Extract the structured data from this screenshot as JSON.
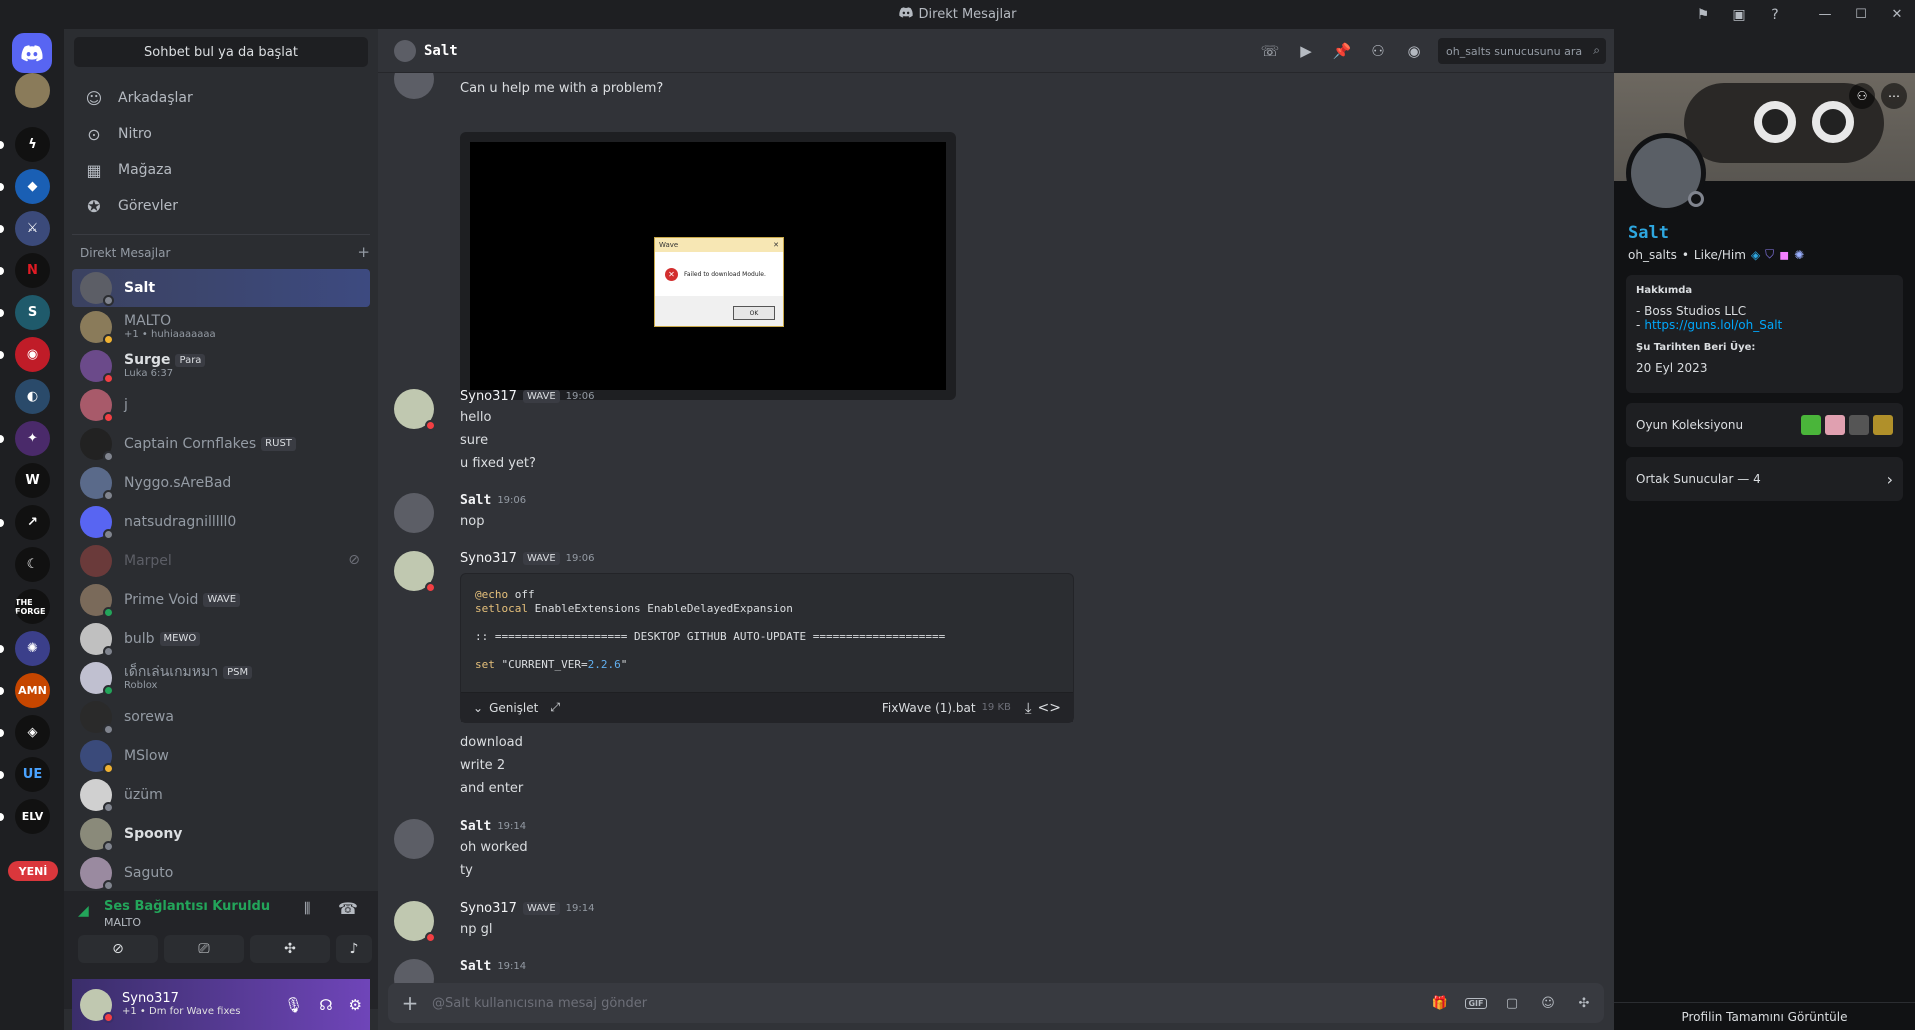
{
  "window": {
    "title": "Direkt Mesajlar",
    "controls": [
      "inbox-flag-icon",
      "inbox-icon",
      "help-icon"
    ]
  },
  "rail": {
    "new_badge": "YENİ",
    "servers": [
      {
        "name": "discord-home",
        "color": "#5865f2"
      },
      {
        "name": "server-a",
        "color": "#8a7b5a"
      },
      {
        "name": "server-b",
        "color": "#111111"
      },
      {
        "name": "server-c",
        "color": "#1a5fb4"
      },
      {
        "name": "server-d",
        "color": "#3b4a7a"
      },
      {
        "name": "server-e",
        "color": "#111111"
      },
      {
        "name": "server-f",
        "color": "#1f5a6b"
      },
      {
        "name": "server-g",
        "color": "#c01c28"
      },
      {
        "name": "server-h",
        "color": "#2a4a6a"
      },
      {
        "name": "server-i",
        "color": "#4a2a6a"
      },
      {
        "name": "server-j",
        "color": "#111111"
      },
      {
        "name": "server-k",
        "color": "#111111"
      },
      {
        "name": "server-l",
        "color": "#111111"
      },
      {
        "name": "server-forge",
        "color": "#111111",
        "text": "THE FORGE"
      },
      {
        "name": "server-m",
        "color": "#3b3f8a"
      },
      {
        "name": "server-amn",
        "color": "#c64600",
        "text": "AMN"
      },
      {
        "name": "server-n",
        "color": "#111111"
      },
      {
        "name": "server-ue",
        "color": "#111111",
        "text": "UE"
      },
      {
        "name": "server-elv",
        "color": "#111111",
        "text": "ELV"
      }
    ]
  },
  "sidebar": {
    "find_button": "Sohbet bul ya da başlat",
    "nav": [
      {
        "label": "Arkadaşlar",
        "icon": "friends-icon"
      },
      {
        "label": "Nitro",
        "icon": "nitro-icon"
      },
      {
        "label": "Mağaza",
        "icon": "shop-icon"
      },
      {
        "label": "Görevler",
        "icon": "quests-icon"
      }
    ],
    "dm_header": "Direkt Mesajlar",
    "dms": [
      {
        "name": "Salt",
        "sub": "",
        "tag": "",
        "status": "#80848e",
        "bold": true,
        "active": true,
        "avatar": "#5c5e66"
      },
      {
        "name": "MALTO",
        "sub": "+1 • huhiaaaaaaa",
        "tag": "",
        "status": "#f0b232",
        "bold": false,
        "avatar": "#8a7b5a"
      },
      {
        "name": "Surge",
        "sub": "Luka 6:37",
        "tag": "Para",
        "status": "#f23f43",
        "bold": true,
        "avatar": "#6b4a8a"
      },
      {
        "name": "j",
        "sub": "",
        "tag": "",
        "status": "#f23f43",
        "bold": false,
        "avatar": "#a85a6a"
      },
      {
        "name": "Captain Cornflakes",
        "sub": "",
        "tag": "RUST",
        "status": "#80848e",
        "bold": false,
        "avatar": "#222222"
      },
      {
        "name": "Nyggo.sAreBad",
        "sub": "",
        "tag": "",
        "status": "#80848e",
        "bold": false,
        "avatar": "#5a6a8a"
      },
      {
        "name": "natsudragnilllll0",
        "sub": "",
        "tag": "",
        "status": "#80848e",
        "bold": false,
        "avatar": "#5865f2"
      },
      {
        "name": "Marpel",
        "sub": "",
        "tag": "",
        "status": "",
        "bold": false,
        "muted": true,
        "avatar": "#6a3a3a"
      },
      {
        "name": "Prime Void",
        "sub": "",
        "tag": "WAVE",
        "status": "#23a55a",
        "bold": false,
        "avatar": "#7a6a5a"
      },
      {
        "name": "bulb",
        "sub": "",
        "tag": "MEWO",
        "status": "#80848e",
        "bold": false,
        "avatar": "#c0c0c0"
      },
      {
        "name": "เด็กเล่นเกมหมา",
        "sub": "Roblox",
        "tag": "PSM",
        "status": "#23a55a",
        "bold": false,
        "avatar": "#c0c0d0"
      },
      {
        "name": "sorewa",
        "sub": "",
        "tag": "",
        "status": "#80848e",
        "bold": false,
        "avatar": "#2a2a2a"
      },
      {
        "name": "MSlow",
        "sub": "",
        "tag": "",
        "status": "#f0b232",
        "bold": false,
        "avatar": "#3a4a7a"
      },
      {
        "name": "üzüm",
        "sub": "",
        "tag": "",
        "status": "#80848e",
        "bold": false,
        "avatar": "#d0d0d0"
      },
      {
        "name": "Spoony",
        "sub": "",
        "tag": "",
        "status": "#80848e",
        "bold": true,
        "avatar": "#8a8a7a"
      },
      {
        "name": "Saguto",
        "sub": "",
        "tag": "",
        "status": "#80848e",
        "bold": false,
        "avatar": "#9a8aa0"
      }
    ],
    "voice": {
      "title": "Ses Bağlantısı Kuruldu",
      "channel": "MALTO"
    },
    "user": {
      "name": "Syno317",
      "status": "+1 • Dm for Wave fixes"
    }
  },
  "chat": {
    "header_name": "Salt",
    "search_placeholder": "oh_salts sunucusunu ara",
    "composer_placeholder": "@Salt kullanıcısına mesaj gönder",
    "first_line": "Can u help me with a problem?",
    "dialog": {
      "title": "Wave",
      "text": "Failed to download Module.",
      "ok": "OK"
    },
    "messages": [
      {
        "author": "Syno317",
        "tag": "WAVE",
        "time": "19:06",
        "lines": [
          "hello",
          "sure",
          "u fixed yet?"
        ]
      },
      {
        "author": "Salt",
        "tag": "",
        "time": "19:06",
        "lines": [
          "nop"
        ]
      },
      {
        "author": "Syno317",
        "tag": "WAVE",
        "time": "19:06",
        "lines": []
      },
      {
        "author": "Salt",
        "tag": "",
        "time": "19:14",
        "lines": [
          "oh worked",
          "ty"
        ]
      },
      {
        "author": "Syno317",
        "tag": "WAVE",
        "time": "19:14",
        "lines": [
          "np gl"
        ]
      },
      {
        "author": "Salt",
        "tag": "",
        "time": "19:14",
        "lines": []
      }
    ],
    "code": {
      "lines": [
        "@echo off",
        "setlocal EnableExtensions EnableDelayedExpansion",
        ":: ==================== DESKTOP GITHUB AUTO-UPDATE ====================",
        "set \"CURRENT_VER=2.2.6\""
      ],
      "expand_label": "Genişlet",
      "file_name": "FixWave (1).bat",
      "file_size": "19 KB"
    },
    "after_code_lines": [
      "download",
      "write 2",
      "and enter"
    ]
  },
  "profile": {
    "name": "Salt",
    "handle": "oh_salts",
    "pronouns": "Like/Him",
    "about_label": "Hakkımda",
    "about_lines": [
      "- Boss Studios LLC",
      "https://guns.lol/oh_Salt"
    ],
    "member_since_label": "Şu Tarihten Beri Üye:",
    "member_since": "20 Eyl 2023",
    "game_collection": "Oyun Koleksiyonu",
    "mutual_servers": "Ortak Sunucular — 4",
    "view_full": "Profilin Tamamını Görüntüle"
  }
}
